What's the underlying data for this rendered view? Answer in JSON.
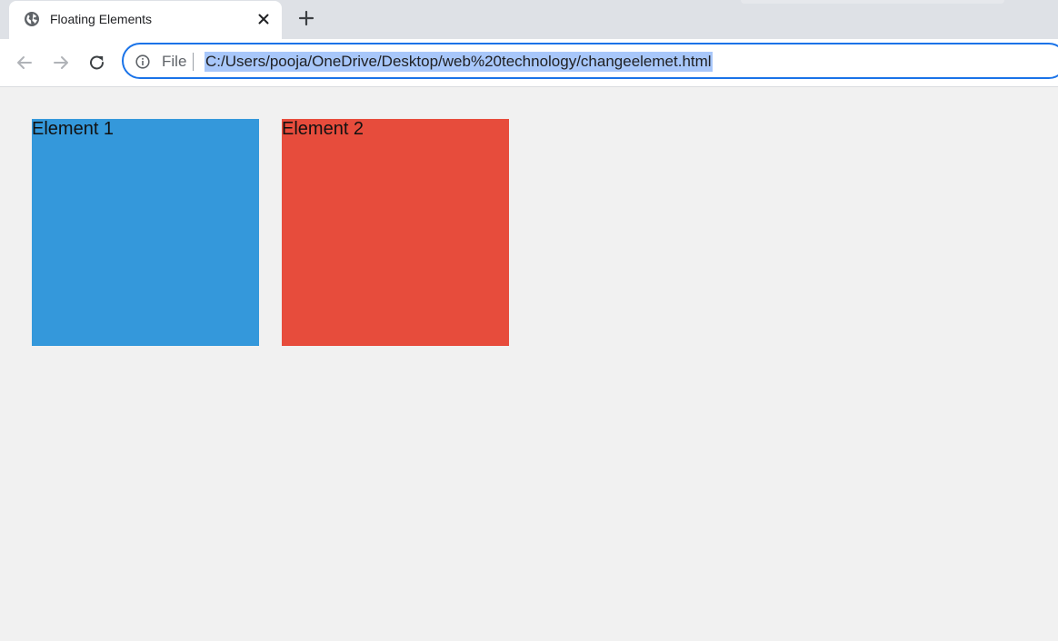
{
  "browser": {
    "tab": {
      "title": "Floating Elements",
      "favicon": "globe-icon",
      "close_icon": "close-icon"
    },
    "new_tab_icon": "plus-icon",
    "nav": {
      "back_icon": "arrow-left-icon",
      "forward_icon": "arrow-right-icon",
      "reload_icon": "reload-icon"
    },
    "omnibox": {
      "info_icon": "info-icon",
      "scheme_label": "File",
      "url": "C:/Users/pooja/OneDrive/Desktop/web%20technology/changeelemet.html",
      "url_selected": true,
      "focus_color": "#1a73e8",
      "selection_color": "#a8c7fa"
    }
  },
  "page": {
    "background": "#f1f1f1",
    "elements": [
      {
        "label": "Element 1",
        "color": "#3498db"
      },
      {
        "label": "Element 2",
        "color": "#e74c3c"
      }
    ]
  }
}
